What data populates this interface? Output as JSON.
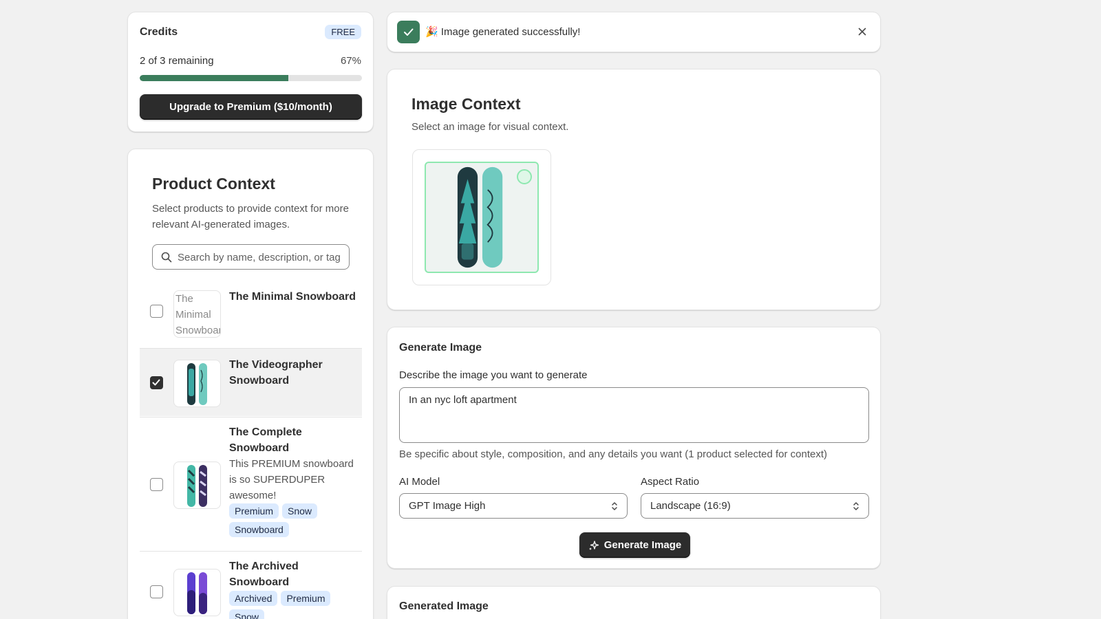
{
  "colors": {
    "accent_green": "#3b7d5c",
    "badge_blue": "#dbeafe",
    "button_dark": "#2c2c2c",
    "selection_green": "#8ee8b0"
  },
  "credits": {
    "title": "Credits",
    "plan_badge": "FREE",
    "remaining_text": "2 of 3 remaining",
    "percent_label": "67%",
    "progress_fraction": 0.67,
    "upgrade_label": "Upgrade to Premium ($10/month)"
  },
  "product_context": {
    "title": "Product Context",
    "subtitle": "Select products to provide context for more relevant AI-generated images.",
    "search_placeholder": "Search by name, description, or tags",
    "products": [
      {
        "name": "The Minimal Snowboard",
        "thumb_alt": "The Minimal Snowboard",
        "checked": false,
        "description": "",
        "tags": []
      },
      {
        "name": "The Videographer Snowboard",
        "checked": true,
        "description": "",
        "tags": []
      },
      {
        "name": "The Complete Snowboard",
        "checked": false,
        "description": "This PREMIUM snowboard is so SUPERDUPER awesome!",
        "tags": [
          "Premium",
          "Snow",
          "Snowboard"
        ]
      },
      {
        "name": "The Archived Snowboard",
        "checked": false,
        "description": "",
        "tags": [
          "Archived",
          "Premium",
          "Snow"
        ]
      }
    ]
  },
  "toast": {
    "message": "🎉 Image generated successfully!",
    "close_icon": "close-icon",
    "status_icon": "checkmark-icon"
  },
  "image_context": {
    "title": "Image Context",
    "subtitle": "Select an image for visual context."
  },
  "generate": {
    "title": "Generate Image",
    "prompt_label": "Describe the image you want to generate",
    "prompt_value": "In an nyc loft apartment",
    "help_text": "Be specific about style, composition, and any details you want (1 product selected for context)",
    "model_label": "AI Model",
    "model_value": "GPT Image High",
    "aspect_label": "Aspect Ratio",
    "aspect_value": "Landscape (16:9)",
    "button_label": "Generate Image"
  },
  "generated": {
    "title": "Generated Image"
  }
}
